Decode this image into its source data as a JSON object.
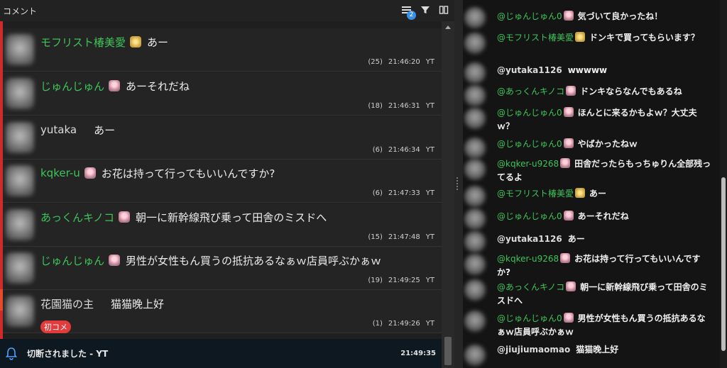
{
  "left_panel": {
    "title": "コメント",
    "filter_badge": "2",
    "comments": [
      {
        "name": "モフリスト椿美愛",
        "name_color": "green",
        "emoji": "star",
        "message": "あー",
        "count": "(25)",
        "time": "21:46:20",
        "source": "YT"
      },
      {
        "name": "じゅんじゅん",
        "name_color": "green",
        "emoji": "girl",
        "message": "あーそれだね",
        "count": "(18)",
        "time": "21:46:31",
        "source": "YT"
      },
      {
        "name": "yutaka",
        "name_color": "gray",
        "emoji": "",
        "message": "あー",
        "count": "(6)",
        "time": "21:46:34",
        "source": "YT"
      },
      {
        "name": "kqker-u",
        "name_color": "green",
        "emoji": "girl",
        "message": "お花は持って行ってもいいんですか?",
        "count": "(6)",
        "time": "21:47:33",
        "source": "YT"
      },
      {
        "name": "あっくんキノコ",
        "name_color": "green",
        "emoji": "girl",
        "message": "朝一に新幹線飛び乗って田舎のミスドへ",
        "count": "(15)",
        "time": "21:47:48",
        "source": "YT"
      },
      {
        "name": "じゅんじゅん",
        "name_color": "green",
        "emoji": "girl",
        "message": "男性が女性もん買うの抵抗あるなぁｗ店員呼ぶかぁｗ",
        "count": "(19)",
        "time": "21:49:25",
        "source": "YT"
      },
      {
        "name": "花園猫の主",
        "name_color": "gray",
        "emoji": "",
        "message": "猫猫晚上好",
        "count": "(1)",
        "time": "21:49:26",
        "source": "YT",
        "badge": "初コメ"
      }
    ],
    "status": {
      "text": "切断されました - YT",
      "time": "21:49:35"
    }
  },
  "right_panel": {
    "messages": [
      {
        "user": "@じゅんじゅん0",
        "user_color": "green",
        "emoji": "girl",
        "text": "気づいて良かったね！"
      },
      {
        "user": "@モフリスト椿美愛",
        "user_color": "green",
        "emoji": "star",
        "text": "ドンキで買ってもらいます？"
      },
      {
        "user": "@yutaka1126",
        "user_color": "gray",
        "emoji": "",
        "text": "wwwww"
      },
      {
        "user": "@あっくんキノコ",
        "user_color": "green",
        "emoji": "girl",
        "text": "ドンキならなんでもあるね"
      },
      {
        "user": "@じゅんじゅん0",
        "user_color": "green",
        "emoji": "girl",
        "text": "ほんとに来るかもよｗ？大丈夫ｗ？"
      },
      {
        "user": "@じゅんじゅん0",
        "user_color": "green",
        "emoji": "girl",
        "text": "やばかったねｗ"
      },
      {
        "user": "@kqker-u9268",
        "user_color": "green",
        "emoji": "girl",
        "text": "田舎だったらもっちゅりん全部残ってるよ"
      },
      {
        "user": "@モフリスト椿美愛",
        "user_color": "green",
        "emoji": "star",
        "text": "あー"
      },
      {
        "user": "@じゅんじゅん0",
        "user_color": "green",
        "emoji": "girl",
        "text": "あーそれだね"
      },
      {
        "user": "@yutaka1126",
        "user_color": "gray",
        "emoji": "",
        "text": "あー"
      },
      {
        "user": "@kqker-u9268",
        "user_color": "green",
        "emoji": "girl",
        "text": "お花は持って行ってもいいんですか?"
      },
      {
        "user": "@あっくんキノコ",
        "user_color": "green",
        "emoji": "girl",
        "text": "朝一に新幹線飛び乗って田舎のミスドへ"
      },
      {
        "user": "@じゅんじゅん0",
        "user_color": "green",
        "emoji": "girl",
        "text": "男性が女性もん買うの抵抗あるなぁｗ店員呼ぶかぁｗ"
      },
      {
        "user": "@jiujiumaomao",
        "user_color": "gray",
        "emoji": "",
        "text": "猫猫晚上好"
      }
    ]
  },
  "colors": {
    "accent_green": "#3ec45a",
    "live_red": "#d12a2a",
    "badge_blue": "#3b8ee8"
  }
}
